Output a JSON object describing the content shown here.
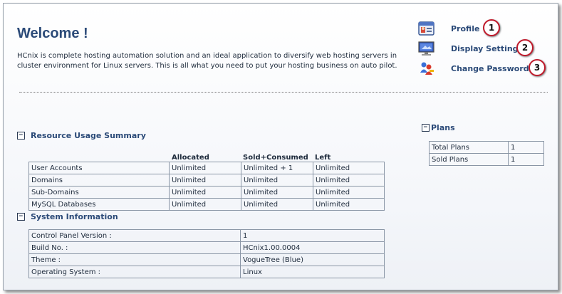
{
  "page": {
    "title": "Welcome !",
    "intro": "HCnix is complete hosting automation solution and an ideal application to diversify web hosting servers in cluster environment for Linux servers. This is all what you need to put your hosting business on auto pilot."
  },
  "quick_links": [
    {
      "label": "Profile",
      "badge": "1",
      "icon": "profile-icon"
    },
    {
      "label": "Display Settings",
      "badge": "2",
      "icon": "display-settings-icon"
    },
    {
      "label": "Change Password",
      "badge": "3",
      "icon": "change-password-icon"
    }
  ],
  "resource_usage": {
    "heading": "Resource Usage Summary",
    "toggle": "−",
    "columns": [
      "Allocated",
      "Sold+Consumed",
      "Left"
    ],
    "rows": [
      [
        "User Accounts",
        "Unlimited",
        "Unlimited + 1",
        "Unlimited"
      ],
      [
        "Domains",
        "Unlimited",
        "Unlimited",
        "Unlimited"
      ],
      [
        "Sub-Domains",
        "Unlimited",
        "Unlimited",
        "Unlimited"
      ],
      [
        "MySQL Databases",
        "Unlimited",
        "Unlimited",
        "Unlimited"
      ]
    ]
  },
  "system_info": {
    "heading": "System Information",
    "toggle": "−",
    "rows": [
      [
        "Control Panel Version :",
        "1"
      ],
      [
        "Build No. :",
        "HCnix1.00.0004"
      ],
      [
        "Theme :",
        "VogueTree (Blue)"
      ],
      [
        "Operating System :",
        "Linux"
      ]
    ]
  },
  "plans": {
    "heading": "Plans",
    "toggle": "−",
    "rows": [
      [
        "Total Plans",
        "1"
      ],
      [
        "Sold Plans",
        "1"
      ]
    ]
  },
  "colors": {
    "heading": "#2b4a78",
    "border": "#8a96a6",
    "badge_ring": "#c0192a"
  }
}
